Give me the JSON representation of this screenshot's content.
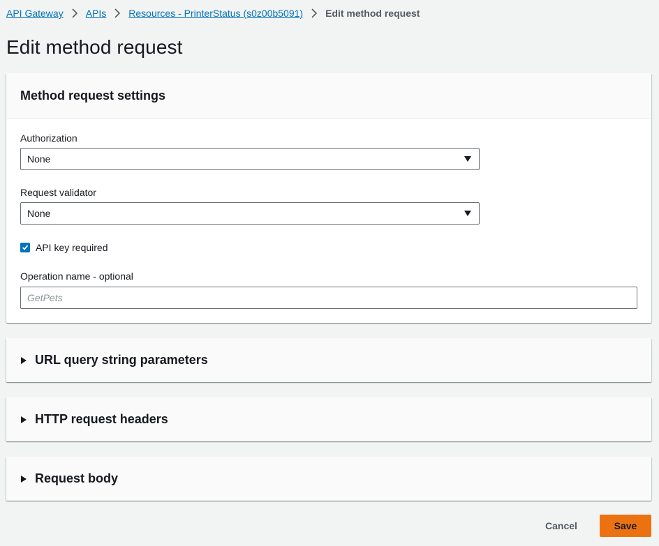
{
  "breadcrumb": {
    "items": [
      "API Gateway",
      "APIs",
      "Resources - PrinterStatus (s0z00b5091)"
    ],
    "current": "Edit method request"
  },
  "page": {
    "title": "Edit method request"
  },
  "settings": {
    "title": "Method request settings",
    "authorization": {
      "label": "Authorization",
      "value": "None"
    },
    "validator": {
      "label": "Request validator",
      "value": "None"
    },
    "api_key": {
      "label": "API key required",
      "checked": true
    },
    "operation": {
      "label": "Operation name - optional",
      "placeholder": "GetPets",
      "value": ""
    }
  },
  "sections": [
    {
      "title": "URL query string parameters"
    },
    {
      "title": "HTTP request headers"
    },
    {
      "title": "Request body"
    }
  ],
  "actions": {
    "cancel": "Cancel",
    "save": "Save"
  },
  "colors": {
    "link": "#0073bb",
    "primary": "#ec7211",
    "checkbox": "#0073bb"
  }
}
